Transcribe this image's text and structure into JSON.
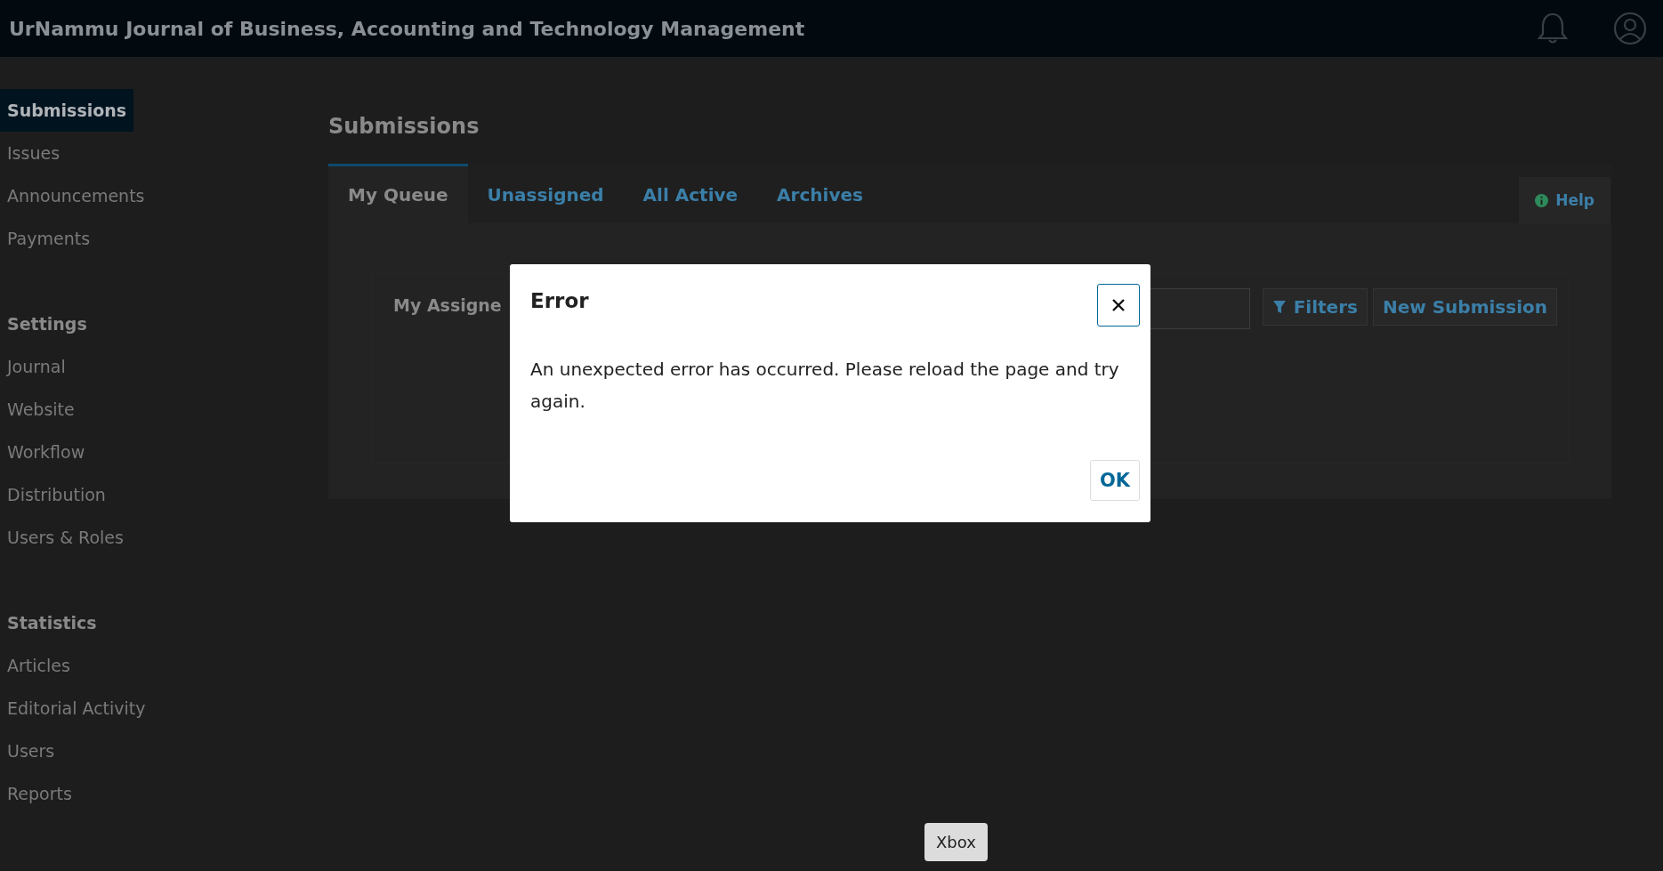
{
  "header": {
    "title": "UrNammu Journal of Business, Accounting and Technology Management"
  },
  "sidebar": {
    "sections": [
      {
        "items": [
          {
            "label": "Submissions",
            "selected": true
          },
          {
            "label": "Issues",
            "selected": false
          },
          {
            "label": "Announcements",
            "selected": false
          },
          {
            "label": "Payments",
            "selected": false
          }
        ]
      },
      {
        "heading": "Settings",
        "items": [
          {
            "label": "Journal",
            "selected": false
          },
          {
            "label": "Website",
            "selected": false
          },
          {
            "label": "Workflow",
            "selected": false
          },
          {
            "label": "Distribution",
            "selected": false
          },
          {
            "label": "Users & Roles",
            "selected": false
          }
        ]
      },
      {
        "heading": "Statistics",
        "items": [
          {
            "label": "Articles",
            "selected": false
          },
          {
            "label": "Editorial Activity",
            "selected": false
          },
          {
            "label": "Users",
            "selected": false
          },
          {
            "label": "Reports",
            "selected": false
          }
        ]
      }
    ]
  },
  "main": {
    "title": "Submissions",
    "tabs": [
      {
        "label": "My Queue",
        "selected": true
      },
      {
        "label": "Unassigned",
        "selected": false
      },
      {
        "label": "All Active",
        "selected": false
      },
      {
        "label": "Archives",
        "selected": false
      }
    ],
    "help": "Help",
    "panel": {
      "title": "My Assigne",
      "filters": "Filters",
      "new_submission": "New Submission"
    }
  },
  "dialog": {
    "title": "Error",
    "message": "An unexpected error has occurred. Please reload the page and try again.",
    "ok": "OK"
  },
  "tooltip": "Xbox"
}
